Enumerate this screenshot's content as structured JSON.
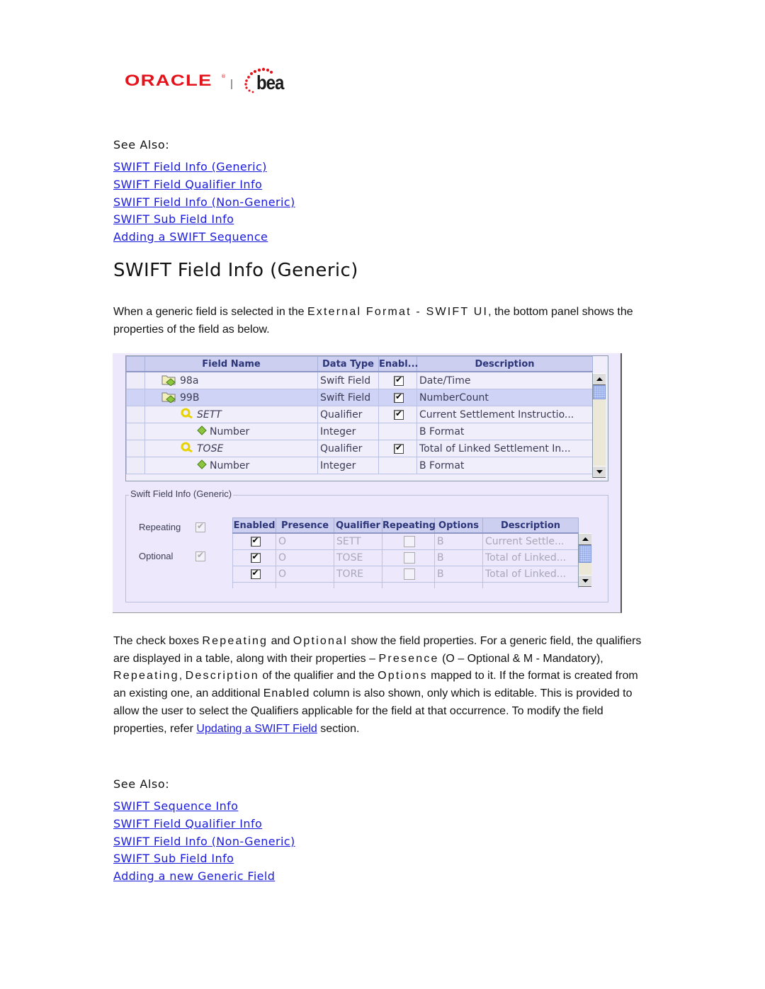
{
  "logo": {
    "oracle": "ORACLE",
    "reg": "®",
    "bea": "bea"
  },
  "see_also_top": {
    "label": "See Also:",
    "links": [
      "SWIFT Field Info (Generic)",
      "SWIFT Field Qualifier Info",
      "SWIFT Field Info (Non-Generic)",
      "SWIFT Sub Field Info",
      "Adding a SWIFT Sequence"
    ]
  },
  "heading": "SWIFT Field Info (Generic)",
  "intro": {
    "part1": "When a generic field is selected in the ",
    "spaced": "External Format - SWIFT UI",
    "part2": ", the bottom panel shows the properties of the field as below."
  },
  "field_grid": {
    "columns": [
      "",
      "Field Name",
      "Data Type",
      "Enabl...",
      "Description"
    ],
    "rows": [
      {
        "icon": "folder-field-icon",
        "indent": 1,
        "name": "98a",
        "italic": false,
        "type": "Swift Field",
        "enabled": true,
        "description": "Date/Time",
        "selected": false
      },
      {
        "icon": "folder-field-icon",
        "indent": 1,
        "name": "99B",
        "italic": false,
        "type": "Swift Field",
        "enabled": true,
        "description": "NumberCount",
        "selected": true
      },
      {
        "icon": "qualifier-icon",
        "indent": 2,
        "name": "SETT",
        "italic": true,
        "type": "Qualifier",
        "enabled": true,
        "description": "Current Settlement Instructio...",
        "selected": false
      },
      {
        "icon": "diamond-icon",
        "indent": 3,
        "name": "Number",
        "italic": false,
        "type": "Integer",
        "enabled": null,
        "description": "B Format",
        "selected": false
      },
      {
        "icon": "qualifier-icon",
        "indent": 2,
        "name": "TOSE",
        "italic": true,
        "type": "Qualifier",
        "enabled": true,
        "description": "Total of Linked Settlement In...",
        "selected": false
      },
      {
        "icon": "diamond-icon",
        "indent": 3,
        "name": "Number",
        "italic": false,
        "type": "Integer",
        "enabled": null,
        "description": "B Format",
        "selected": false
      }
    ]
  },
  "generic_panel": {
    "title": "Swift Field Info (Generic)",
    "repeating_label": "Repeating",
    "repeating_checked": true,
    "optional_label": "Optional",
    "optional_checked": true,
    "columns": [
      "Enabled",
      "Presence",
      "Qualifier",
      "Repeating",
      "Options",
      "Description"
    ],
    "rows": [
      {
        "enabled": true,
        "presence": "O",
        "qualifier": "SETT",
        "repeating": false,
        "options": "B",
        "description": "Current Settle..."
      },
      {
        "enabled": true,
        "presence": "O",
        "qualifier": "TOSE",
        "repeating": false,
        "options": "B",
        "description": "Total of Linked..."
      },
      {
        "enabled": true,
        "presence": "O",
        "qualifier": "TORE",
        "repeating": false,
        "options": "B",
        "description": "Total of Linked..."
      }
    ]
  },
  "body": {
    "s1": "The check boxes ",
    "repeating": "Repeating",
    "s2": " and ",
    "optional": "Optional",
    "s3": " show the field properties. For a generic field, the qualifiers are displayed in a table, along with their properties – ",
    "presence": "Presence",
    "s4": " (O – Optional & M - Mandatory), ",
    "repeating2": "Repeating",
    "s5": ", ",
    "description": "Description",
    "s6": " of the qualifier and the ",
    "options": "Options",
    "s7": " mapped to it. If the format is created from an existing one, an additional ",
    "enabled": "Enabled",
    "s8": " column is also shown, only which is editable. This is provided to allow the user to select the Qualifiers applicable for the field at that occurrence. To modify the field properties, refer ",
    "link": "Updating a SWIFT Field",
    "s9": " section."
  },
  "see_also_bottom": {
    "label": "See Also:",
    "links": [
      "SWIFT Sequence Info",
      "SWIFT Field Qualifier Info",
      "SWIFT Field Info (Non-Generic)",
      "SWIFT Sub Field Info",
      "Adding a new Generic Field"
    ]
  }
}
